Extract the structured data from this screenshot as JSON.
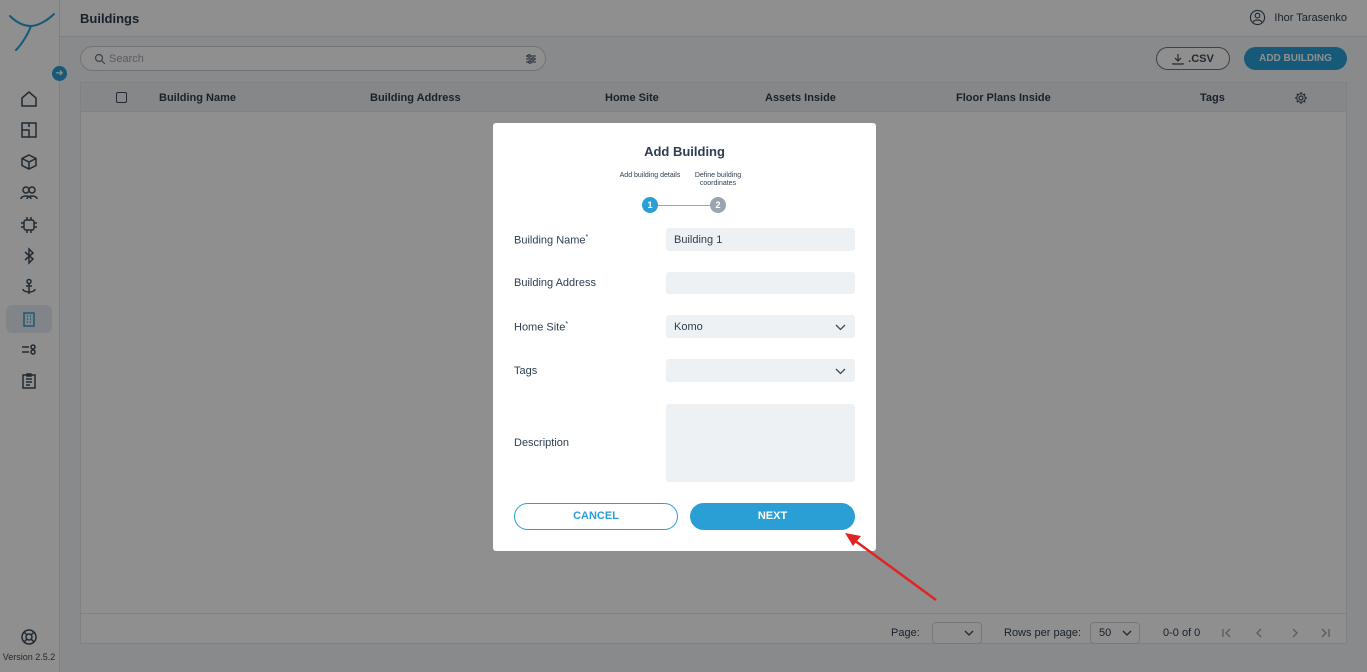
{
  "app": {
    "page_title": "Buildings",
    "user_name": "Ihor Tarasenko",
    "version": "Version 2.5.2"
  },
  "sidebar": {
    "items": [
      {
        "name": "home-icon"
      },
      {
        "name": "floor-plan-icon"
      },
      {
        "name": "cube-icon"
      },
      {
        "name": "people-icon"
      },
      {
        "name": "chip-icon"
      },
      {
        "name": "bluetooth-icon"
      },
      {
        "name": "anchor-icon"
      },
      {
        "name": "building-icon",
        "active": true
      },
      {
        "name": "rules-icon"
      },
      {
        "name": "report-icon"
      }
    ]
  },
  "toolbar": {
    "search_placeholder": "Search",
    "csv_label": ".CSV",
    "add_building_label": "ADD BUILDING"
  },
  "table": {
    "columns": [
      "Building Name",
      "Building Address",
      "Home Site",
      "Assets Inside",
      "Floor Plans Inside",
      "Tags"
    ],
    "footer": {
      "page_label": "Page:",
      "page_value": "",
      "rows_per_page_label": "Rows per page:",
      "rows_per_page_value": "50",
      "range_text": "0-0 of 0"
    }
  },
  "modal": {
    "title": "Add Building",
    "steps": [
      {
        "number": "1",
        "label": "Add building details",
        "state": "active"
      },
      {
        "number": "2",
        "label": "Define building coordinates",
        "state": "inactive"
      }
    ],
    "fields": {
      "building_name": {
        "label": "Building Name",
        "required": true,
        "value": "Building 1"
      },
      "building_address": {
        "label": "Building Address",
        "required": false,
        "value": ""
      },
      "home_site": {
        "label": "Home Site",
        "required": true,
        "value": "Komo"
      },
      "tags": {
        "label": "Tags",
        "required": false,
        "value": ""
      },
      "description": {
        "label": "Description",
        "required": false,
        "value": ""
      }
    },
    "required_marker": "*",
    "cancel_label": "CANCEL",
    "next_label": "NEXT"
  },
  "colors": {
    "accent": "#2a9fd6",
    "annotation_arrow": "#e02424",
    "inactive_step": "#9aa5b1"
  }
}
